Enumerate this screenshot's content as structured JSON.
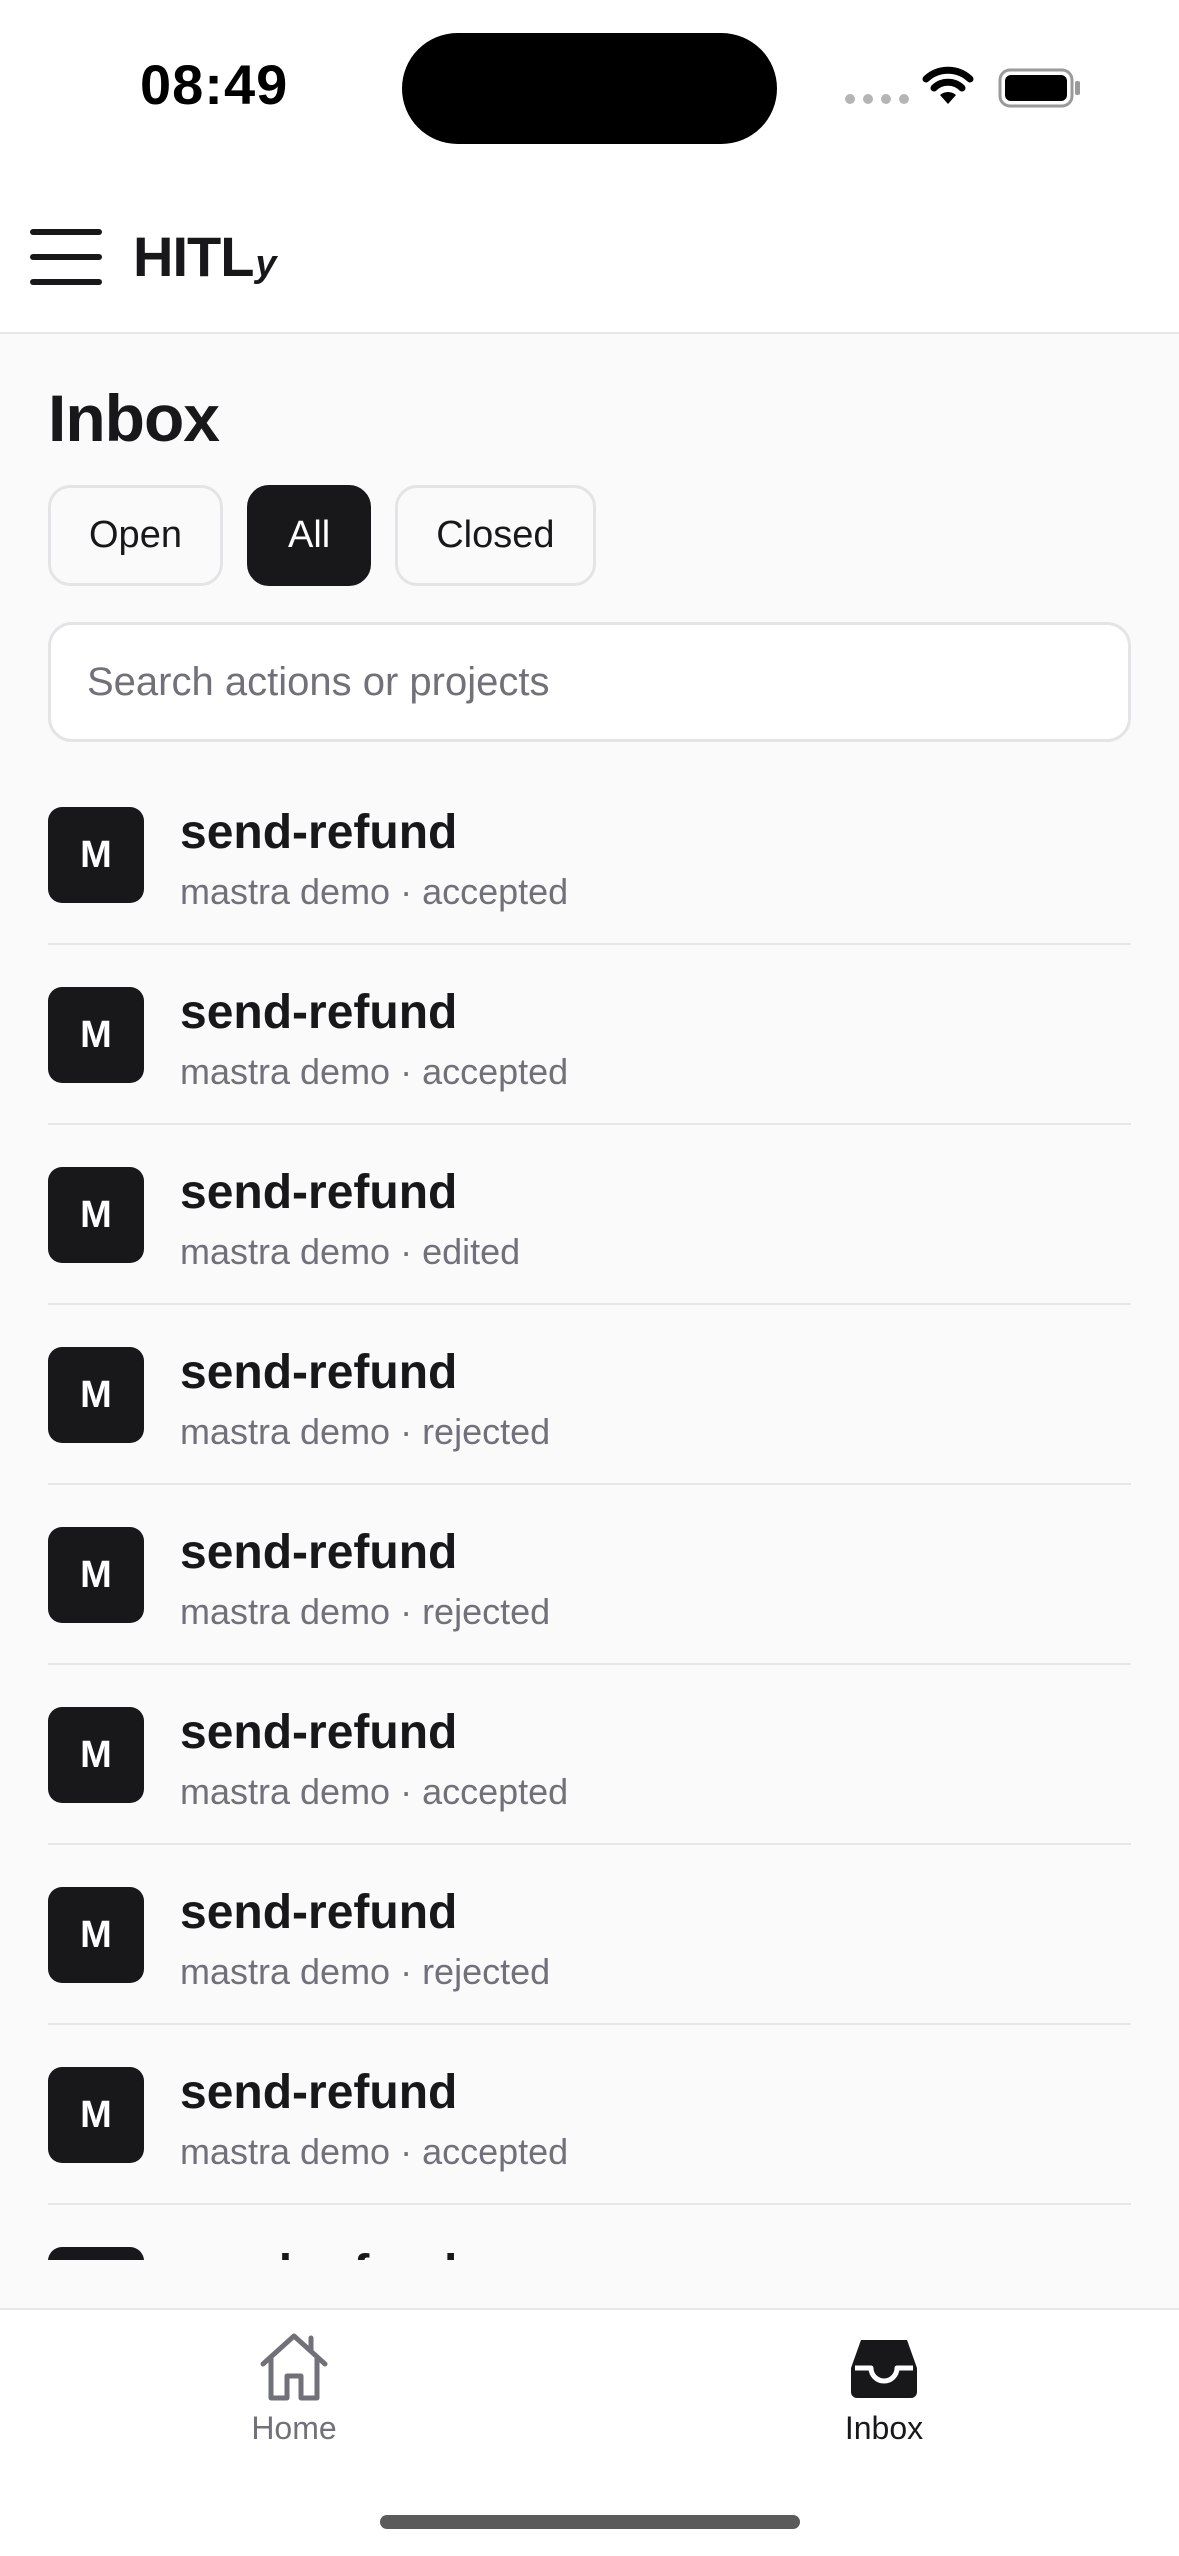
{
  "status_bar": {
    "time": "08:49",
    "icons": [
      "signal-dots-icon",
      "wifi-icon",
      "battery-icon"
    ]
  },
  "header": {
    "menu_icon": "hamburger-menu-icon",
    "logo_main": "HITL",
    "logo_sub": "y"
  },
  "page": {
    "title": "Inbox"
  },
  "filters": [
    {
      "label": "Open",
      "active": false
    },
    {
      "label": "All",
      "active": true
    },
    {
      "label": "Closed",
      "active": false
    }
  ],
  "search": {
    "placeholder": "Search actions or projects",
    "value": ""
  },
  "list": {
    "items": [
      {
        "avatar": "M",
        "title": "send-refund",
        "subtitle": "mastra demo · accepted"
      },
      {
        "avatar": "M",
        "title": "send-refund",
        "subtitle": "mastra demo · accepted"
      },
      {
        "avatar": "M",
        "title": "send-refund",
        "subtitle": "mastra demo · edited"
      },
      {
        "avatar": "M",
        "title": "send-refund",
        "subtitle": "mastra demo · rejected"
      },
      {
        "avatar": "M",
        "title": "send-refund",
        "subtitle": "mastra demo · rejected"
      },
      {
        "avatar": "M",
        "title": "send-refund",
        "subtitle": "mastra demo · accepted"
      },
      {
        "avatar": "M",
        "title": "send-refund",
        "subtitle": "mastra demo · rejected"
      },
      {
        "avatar": "M",
        "title": "send-refund",
        "subtitle": "mastra demo · accepted"
      },
      {
        "avatar": "M",
        "title": "send-refund",
        "subtitle": ""
      }
    ]
  },
  "tab_bar": {
    "home": {
      "label": "Home",
      "icon": "home-icon"
    },
    "inbox": {
      "label": "Inbox",
      "icon": "inbox-tray-icon"
    }
  },
  "colors": {
    "accent": "#18181b",
    "muted_text": "#71717a",
    "border": "#e4e4e7",
    "background": "#fafafa"
  }
}
